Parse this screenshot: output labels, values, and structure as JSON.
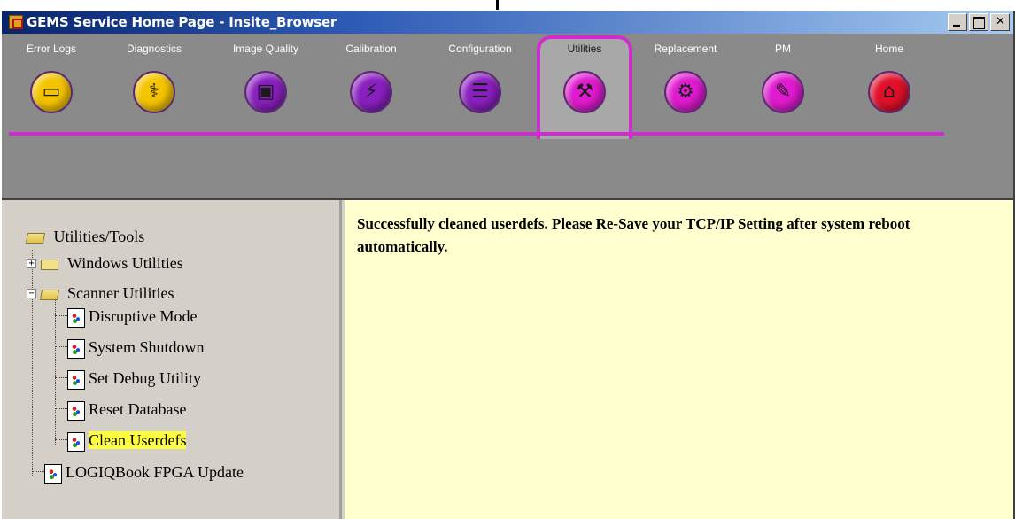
{
  "window": {
    "title": "GEMS Service Home Page - Insite_Browser"
  },
  "tabs": [
    {
      "label": "Error Logs",
      "icon": "error-logs-icon",
      "color": "#f5c400",
      "glyph": "▭"
    },
    {
      "label": "Diagnostics",
      "icon": "stethoscope-icon",
      "color": "#f5c400",
      "glyph": "⚕"
    },
    {
      "label": "Image Quality",
      "icon": "image-quality-icon",
      "color": "#8a1fc0",
      "glyph": "▣"
    },
    {
      "label": "Calibration",
      "icon": "calibration-icon",
      "color": "#8a1fc0",
      "glyph": "⚡"
    },
    {
      "label": "Configuration",
      "icon": "configuration-icon",
      "color": "#8a1fc0",
      "glyph": "☰"
    },
    {
      "label": "Utilities",
      "icon": "utilities-icon",
      "color": "#e01ad0",
      "glyph": "⚒",
      "active": true
    },
    {
      "label": "Replacement",
      "icon": "replacement-icon",
      "color": "#e01ad0",
      "glyph": "⚙"
    },
    {
      "label": "PM",
      "icon": "pm-icon",
      "color": "#e01ad0",
      "glyph": "✎"
    },
    {
      "label": "Home",
      "icon": "home-icon",
      "color": "#e0102a",
      "glyph": "⌂"
    }
  ],
  "tree": {
    "root": "Utilities/Tools",
    "windows_utilities": "Windows Utilities",
    "scanner_utilities": "Scanner Utilities",
    "scanner_items": [
      "Disruptive Mode",
      "System Shutdown",
      "Set Debug Utility",
      "Reset Database",
      "Clean Userdefs"
    ],
    "selected": "Clean Userdefs",
    "logiqbook": "LOGIQBook FPGA Update"
  },
  "message": "Successfully cleaned userdefs. Please Re-Save your TCP/IP Setting after system reboot automatically.",
  "colors": {
    "tab_accent": "#d02ad0",
    "selection_highlight": "#ffff40",
    "message_background": "#ffffd0"
  }
}
